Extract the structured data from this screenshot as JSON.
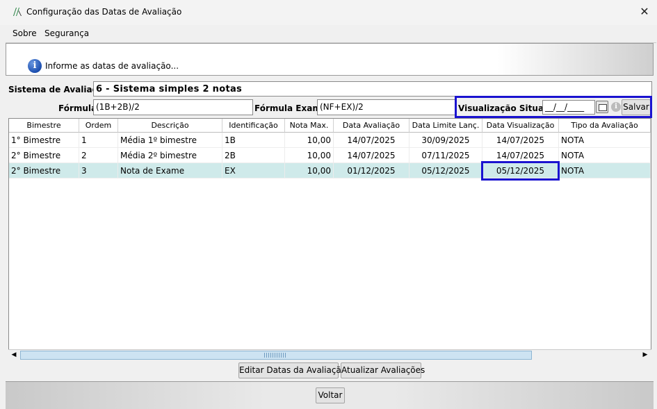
{
  "window": {
    "title": "Configuração das Datas de Avaliação",
    "close_glyph": "✕"
  },
  "menu": {
    "items": [
      "Sobre",
      "Segurança"
    ]
  },
  "banner": {
    "icon": "info-icon",
    "text": "Informe as datas de avaliação..."
  },
  "form": {
    "sistema_label": "Sistema de Avaliação:",
    "sistema_value": "6 - Sistema simples 2 notas",
    "formula_label": "Fórmula:",
    "formula_value": "(1B+2B)/2",
    "formula_exame_label": "Fórmula Exame:",
    "formula_exame_value": "(NF+EX)/2",
    "visualizacao_label": "Visualização Situação:",
    "visualizacao_value": "__/__/____",
    "salvar_label": "Salvar"
  },
  "table": {
    "columns": [
      "Bimestre",
      "Ordem",
      "Descrição",
      "Identificação",
      "Nota Max.",
      "Data Avaliação",
      "Data Limite Lanç.",
      "Data Visualização",
      "Tipo da Avaliação"
    ],
    "rows": [
      [
        "1° Bimestre",
        "1",
        "Média 1º bimestre",
        "1B",
        "10,00",
        "14/07/2025",
        "30/09/2025",
        "14/07/2025",
        "NOTA"
      ],
      [
        "2° Bimestre",
        "2",
        "Média 2º bimestre",
        "2B",
        "10,00",
        "14/07/2025",
        "07/11/2025",
        "14/07/2025",
        "NOTA"
      ],
      [
        "2° Bimestre",
        "3",
        "Nota de Exame",
        "EX",
        "10,00",
        "01/12/2025",
        "05/12/2025",
        "05/12/2025",
        "NOTA"
      ]
    ],
    "selected_row": 2
  },
  "buttons": {
    "editar": "Editar Datas da Avaliação",
    "atualizar": "Atualizar Avaliações",
    "voltar": "Voltar"
  },
  "colors": {
    "highlight_border": "#1a12d0",
    "selected_row_bg": "#cfeaea",
    "info_icon_blue": "#1c4fb0"
  }
}
